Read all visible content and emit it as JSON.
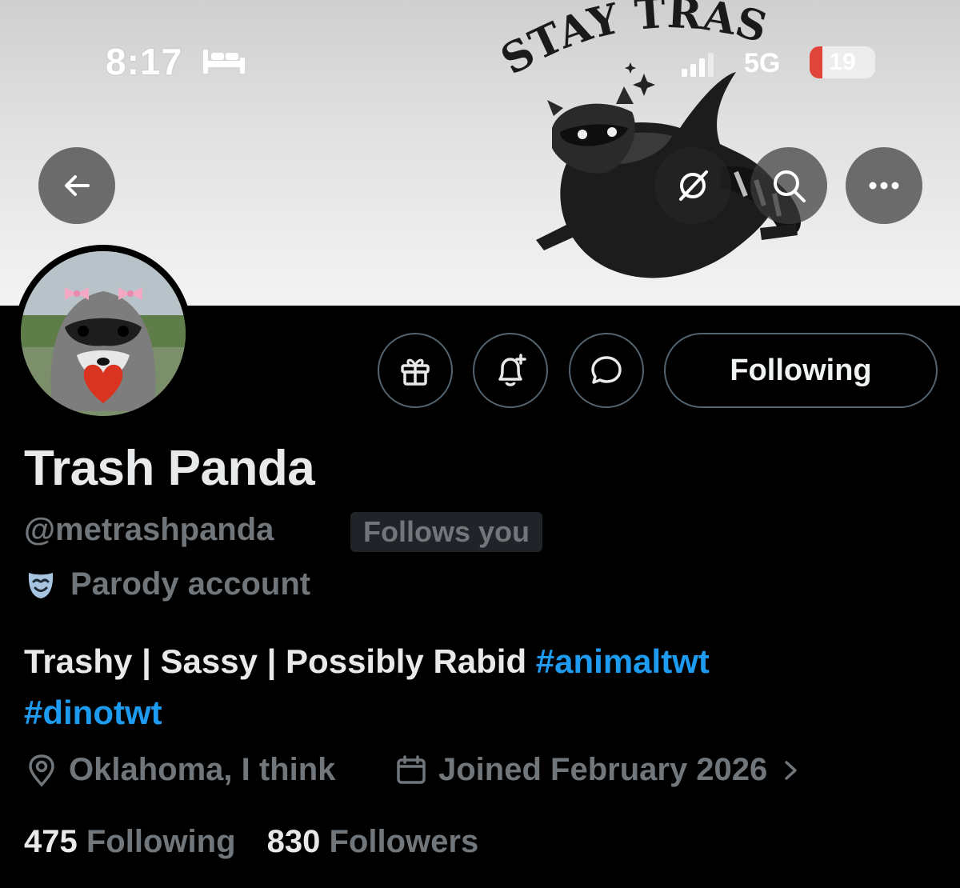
{
  "status_bar": {
    "time": "8:17",
    "network": "5G",
    "battery_level": "19",
    "battery_fraction": 0.19
  },
  "banner": {
    "text": "STAY TRASHY"
  },
  "header": {
    "back_icon": "arrow-left-icon",
    "grok_icon": "grok-icon",
    "search_icon": "search-icon",
    "more_icon": "more-horizontal-icon"
  },
  "actions": {
    "gift_icon": "gift-icon",
    "notify_icon": "bell-plus-icon",
    "message_icon": "chat-bubble-icon",
    "following_label": "Following"
  },
  "profile": {
    "display_name": "Trash Panda",
    "handle": "@metrashpanda",
    "follows_you": "Follows you",
    "parody_label": "Parody account",
    "bio_text": "Trashy | Sassy | Possibly Rabid",
    "bio_hashtags": [
      "#animaltwt",
      "#dinotwt"
    ],
    "location": "Oklahoma, I think",
    "joined": "Joined February 2026",
    "following_count": "475",
    "following_label": "Following",
    "followers_count": "830",
    "followers_label": "Followers"
  },
  "colors": {
    "background": "#000000",
    "accent": "#1d9bf0",
    "secondary_text": "#71767b",
    "primary_text": "#e7e9ea"
  }
}
